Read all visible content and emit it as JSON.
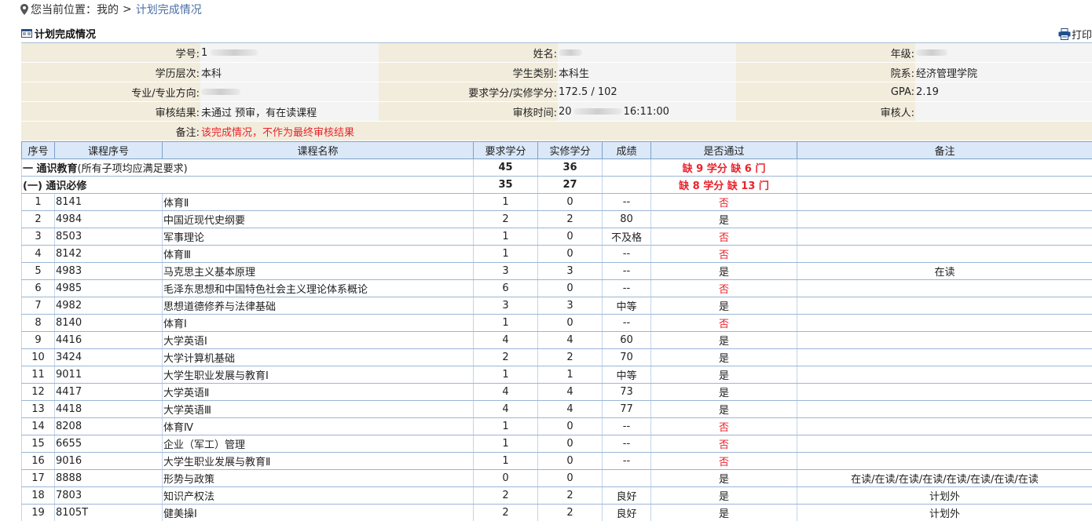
{
  "breadcrumb": {
    "prefix": "您当前位置：我的",
    "separator": ">",
    "current": "计划完成情况"
  },
  "section": {
    "title": "计划完成情况",
    "print_label": "打印"
  },
  "info": {
    "student_id_label": "学号:",
    "student_id_value": "1",
    "name_label": "姓名:",
    "name_value": "",
    "grade_label": "年级:",
    "grade_value": "",
    "edu_level_label": "学历层次:",
    "edu_level_value": "本科",
    "student_type_label": "学生类别:",
    "student_type_value": "本科生",
    "department_label": "院系:",
    "department_value": "经济管理学院",
    "major_label": "专业/专业方向:",
    "major_value": "",
    "credits_label": "要求学分/实修学分:",
    "credits_value": "172.5 / 102",
    "gpa_label": "GPA:",
    "gpa_value": "2.19",
    "audit_result_label": "审核结果:",
    "audit_result_value": "未通过 预审，有在读课程",
    "audit_time_label": "审核时间:",
    "audit_time_value_a": "20",
    "audit_time_value_b": "16:11:00",
    "auditor_label": "审核人:",
    "auditor_value": "",
    "remark_label": "备注:",
    "remark_value": "该完成情况，不作为最终审核结果"
  },
  "table": {
    "headers": [
      "序号",
      "课程序号",
      "课程名称",
      "要求学分",
      "实修学分",
      "成绩",
      "是否通过",
      "备注"
    ],
    "groups": [
      {
        "title": "一 通识教育",
        "note": "(所有子项均应满足要求)",
        "required": "45",
        "earned": "36",
        "pass": "缺 9 学分 缺 6 门"
      },
      {
        "title": "(一) 通识必修",
        "note": "",
        "required": "35",
        "earned": "27",
        "pass": "缺 8 学分 缺 13 门"
      }
    ],
    "rows": [
      {
        "no": "1",
        "code": "8141",
        "name": "体育Ⅱ",
        "req": "1",
        "earned": "0",
        "score": "--",
        "pass": "否",
        "remark": ""
      },
      {
        "no": "2",
        "code": "4984",
        "name": "中国近现代史纲要",
        "req": "2",
        "earned": "2",
        "score": "80",
        "pass": "是",
        "remark": ""
      },
      {
        "no": "3",
        "code": "8503",
        "name": "军事理论",
        "req": "1",
        "earned": "0",
        "score": "不及格",
        "pass": "否",
        "remark": ""
      },
      {
        "no": "4",
        "code": "8142",
        "name": "体育Ⅲ",
        "req": "1",
        "earned": "0",
        "score": "--",
        "pass": "否",
        "remark": ""
      },
      {
        "no": "5",
        "code": "4983",
        "name": "马克思主义基本原理",
        "req": "3",
        "earned": "3",
        "score": "--",
        "pass": "是",
        "remark": "在读"
      },
      {
        "no": "6",
        "code": "4985",
        "name": "毛泽东思想和中国特色社会主义理论体系概论",
        "req": "6",
        "earned": "0",
        "score": "--",
        "pass": "否",
        "remark": ""
      },
      {
        "no": "7",
        "code": "4982",
        "name": "思想道德修养与法律基础",
        "req": "3",
        "earned": "3",
        "score": "中等",
        "pass": "是",
        "remark": ""
      },
      {
        "no": "8",
        "code": "8140",
        "name": "体育Ⅰ",
        "req": "1",
        "earned": "0",
        "score": "--",
        "pass": "否",
        "remark": ""
      },
      {
        "no": "9",
        "code": "4416",
        "name": "大学英语Ⅰ",
        "req": "4",
        "earned": "4",
        "score": "60",
        "pass": "是",
        "remark": ""
      },
      {
        "no": "10",
        "code": "3424",
        "name": "大学计算机基础",
        "req": "2",
        "earned": "2",
        "score": "70",
        "pass": "是",
        "remark": ""
      },
      {
        "no": "11",
        "code": "9011",
        "name": "大学生职业发展与教育Ⅰ",
        "req": "1",
        "earned": "1",
        "score": "中等",
        "pass": "是",
        "remark": ""
      },
      {
        "no": "12",
        "code": "4417",
        "name": "大学英语Ⅱ",
        "req": "4",
        "earned": "4",
        "score": "73",
        "pass": "是",
        "remark": ""
      },
      {
        "no": "13",
        "code": "4418",
        "name": "大学英语Ⅲ",
        "req": "4",
        "earned": "4",
        "score": "77",
        "pass": "是",
        "remark": ""
      },
      {
        "no": "14",
        "code": "8208",
        "name": "体育Ⅳ",
        "req": "1",
        "earned": "0",
        "score": "--",
        "pass": "否",
        "remark": ""
      },
      {
        "no": "15",
        "code": "6655",
        "name": "企业（军工）管理",
        "req": "1",
        "earned": "0",
        "score": "--",
        "pass": "否",
        "remark": ""
      },
      {
        "no": "16",
        "code": "9016",
        "name": "大学生职业发展与教育Ⅱ",
        "req": "1",
        "earned": "0",
        "score": "--",
        "pass": "否",
        "remark": ""
      },
      {
        "no": "17",
        "code": "8888",
        "name": "形势与政策",
        "req": "0",
        "earned": "0",
        "score": "",
        "pass": "是",
        "remark": "在读/在读/在读/在读/在读/在读/在读/在读"
      },
      {
        "no": "18",
        "code": "7803",
        "name": "知识产权法",
        "req": "2",
        "earned": "2",
        "score": "良好",
        "pass": "是",
        "remark": "计划外"
      },
      {
        "no": "19",
        "code": "8105T",
        "name": "健美操Ⅰ",
        "req": "2",
        "earned": "2",
        "score": "良好",
        "pass": "是",
        "remark": "计划外"
      }
    ]
  },
  "colors": {
    "fail": "#e8232c",
    "label_bg": "#f2ecdc",
    "header_bg": "#dbe8f8",
    "link": "#4a6fa5"
  },
  "icons": {
    "location": "location-pin-icon",
    "doc": "table-doc-icon",
    "print": "printer-icon"
  }
}
